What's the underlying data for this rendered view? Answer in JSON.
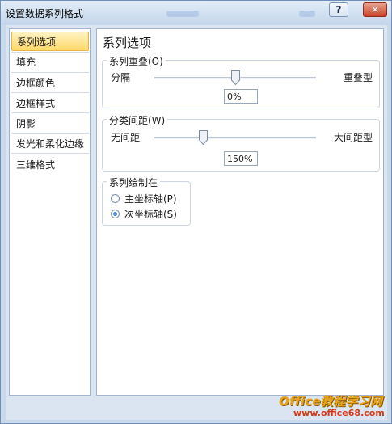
{
  "window": {
    "title": "设置数据系列格式",
    "help_icon": "question-mark",
    "close_icon": "x"
  },
  "nav": {
    "items": [
      {
        "label": "系列选项",
        "active": true
      },
      {
        "label": "填充"
      },
      {
        "label": "边框颜色"
      },
      {
        "label": "边框样式"
      },
      {
        "label": "阴影"
      },
      {
        "label": "发光和柔化边缘"
      },
      {
        "label": "三维格式"
      }
    ]
  },
  "panel": {
    "title": "系列选项",
    "overlap": {
      "legend": "系列重叠(O)",
      "left_label": "分隔",
      "right_label": "重叠型",
      "value": "0%",
      "level_percent": 50
    },
    "gap": {
      "legend": "分类间距(W)",
      "left_label": "无间距",
      "right_label": "大间距型",
      "value": "150%",
      "level_percent": 30
    },
    "plot_on": {
      "legend": "系列绘制在",
      "primary": "主坐标轴(P)",
      "secondary": "次坐标轴(S)",
      "selected": "secondary"
    }
  },
  "watermark": {
    "brand": "Office教程学习网",
    "url": "www.office68.com"
  },
  "colors": {
    "accent_active": "#ffd96b",
    "title_bar": "#cfdff0",
    "close_button": "#c8432b"
  }
}
